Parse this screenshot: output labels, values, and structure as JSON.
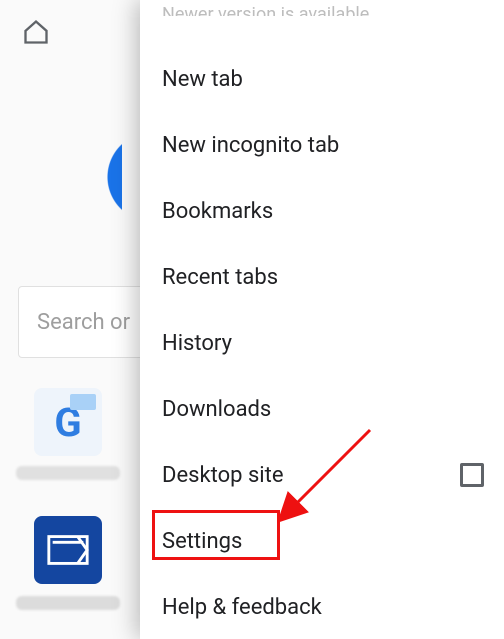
{
  "background": {
    "search_placeholder": "Search or",
    "tile1_letter": "G"
  },
  "menu": {
    "banner": "Newer version is available",
    "items": [
      {
        "label": "New tab"
      },
      {
        "label": "New incognito tab"
      },
      {
        "label": "Bookmarks"
      },
      {
        "label": "Recent tabs"
      },
      {
        "label": "History"
      },
      {
        "label": "Downloads"
      },
      {
        "label": "Desktop site",
        "checkbox": true
      },
      {
        "label": "Settings"
      },
      {
        "label": "Help & feedback"
      }
    ]
  },
  "annotation": {
    "highlighted_item": "Settings"
  }
}
